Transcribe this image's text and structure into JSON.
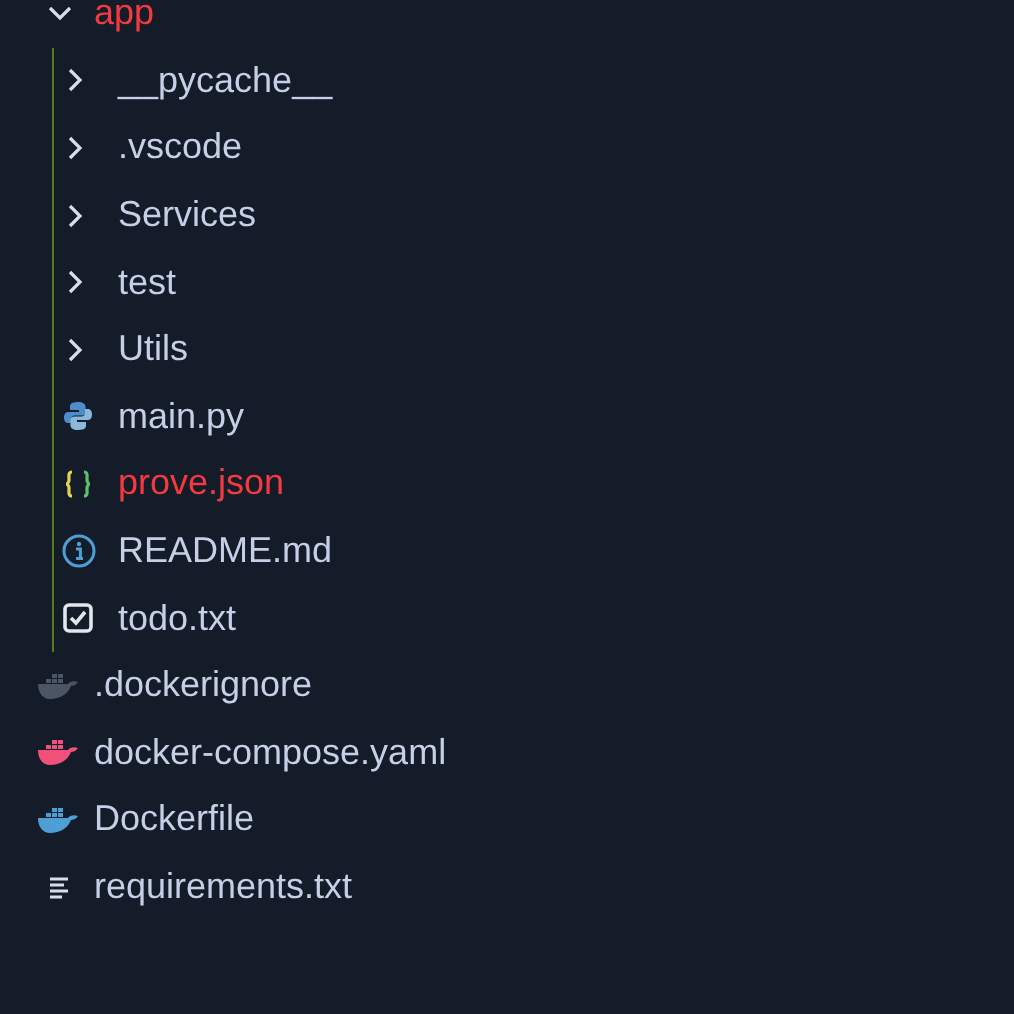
{
  "tree": [
    {
      "label": "app",
      "kind": "folder",
      "expanded": true,
      "error": true,
      "children": [
        {
          "label": "__pycache__",
          "kind": "folder",
          "expanded": false,
          "error": false
        },
        {
          "label": ".vscode",
          "kind": "folder",
          "expanded": false,
          "error": false
        },
        {
          "label": "Services",
          "kind": "folder",
          "expanded": false,
          "error": false
        },
        {
          "label": "test",
          "kind": "folder",
          "expanded": false,
          "error": false
        },
        {
          "label": "Utils",
          "kind": "folder",
          "expanded": false,
          "error": false
        },
        {
          "label": "main.py",
          "kind": "python",
          "error": false
        },
        {
          "label": "prove.json",
          "kind": "json",
          "error": true
        },
        {
          "label": "README.md",
          "kind": "info",
          "error": false
        },
        {
          "label": "todo.txt",
          "kind": "todo",
          "error": false
        }
      ]
    },
    {
      "label": ".dockerignore",
      "kind": "docker",
      "color": "#4b5563",
      "error": false
    },
    {
      "label": "docker-compose.yaml",
      "kind": "docker",
      "color": "#f0507a",
      "error": false
    },
    {
      "label": "Dockerfile",
      "kind": "docker",
      "color": "#4d9fd6",
      "error": false
    },
    {
      "label": "requirements.txt",
      "kind": "text",
      "error": false
    }
  ]
}
